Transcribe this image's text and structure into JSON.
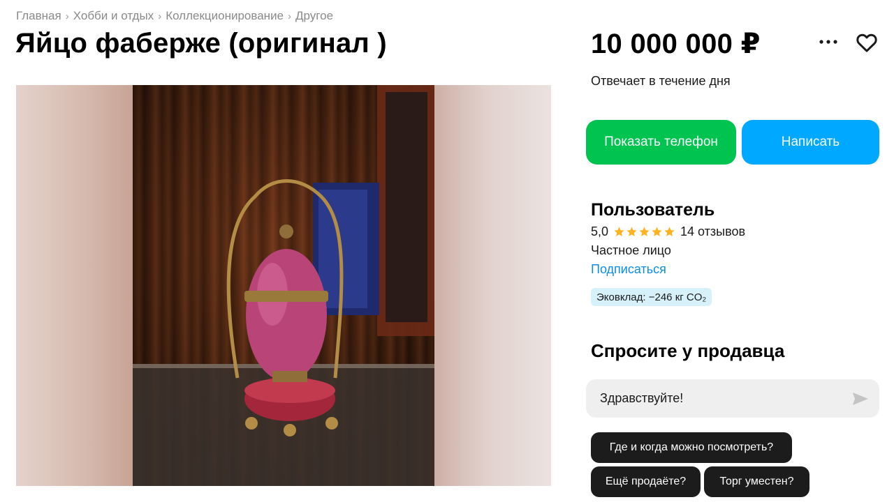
{
  "breadcrumb": {
    "items": [
      "Главная",
      "Хобби и отдых",
      "Коллекционирование",
      "Другое"
    ],
    "separator": "›"
  },
  "listing": {
    "title": "Яйцо фаберже (оригинал )",
    "price": "10 000 000 ₽",
    "response_time": "Отвечает в течение дня"
  },
  "actions": {
    "show_phone": "Показать телефон",
    "write": "Написать"
  },
  "seller": {
    "name": "Пользователь",
    "rating": "5,0",
    "stars": 5,
    "reviews": "14 отзывов",
    "type": "Частное лицо",
    "subscribe": "Подписаться",
    "eco_badge": "Эковклад: −246 кг CO₂"
  },
  "ask": {
    "title": "Спросите у продавца",
    "input_value": "Здравствуйте!",
    "quick_questions": [
      "Где и когда можно посмотреть?",
      "Ещё продаёте?",
      "Торг уместен?"
    ]
  },
  "colors": {
    "phone_button": "#00c44f",
    "write_button": "#00a9ff",
    "link": "#0a8ee8",
    "star": "#ffb21e",
    "eco_badge_bg": "#d7f1fb",
    "chip_bg": "#1c1c1c"
  },
  "icons": {
    "more": "more-dots-icon",
    "favorite": "heart-icon",
    "send": "send-icon",
    "star": "star-icon"
  }
}
